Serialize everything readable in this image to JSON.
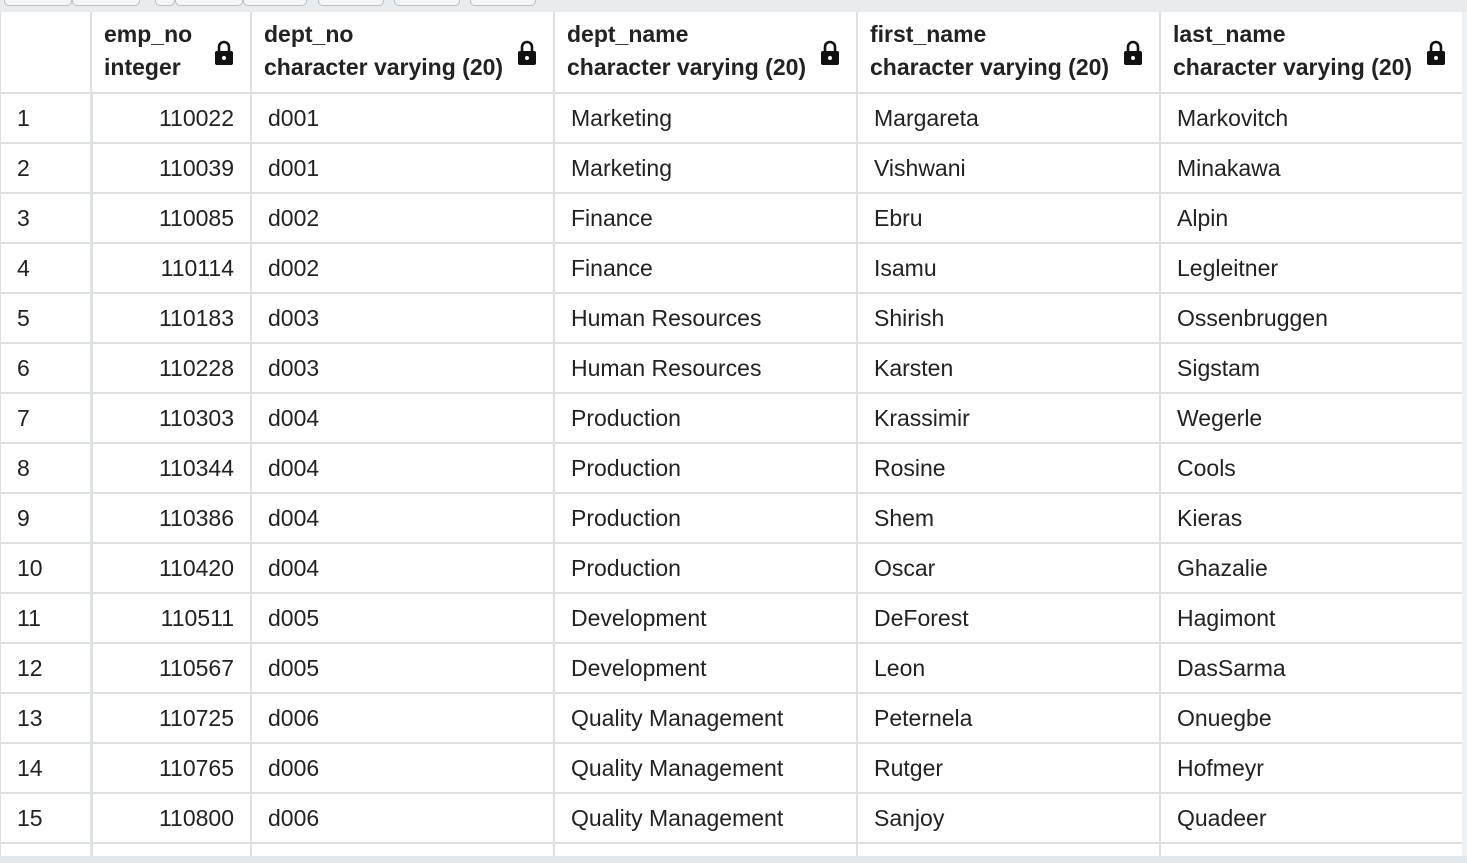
{
  "columns": [
    {
      "name": "emp_no",
      "type": "integer"
    },
    {
      "name": "dept_no",
      "type": "character varying (20)"
    },
    {
      "name": "dept_name",
      "type": "character varying (20)"
    },
    {
      "name": "first_name",
      "type": "character varying (20)"
    },
    {
      "name": "last_name",
      "type": "character varying (20)"
    }
  ],
  "rows": [
    {
      "n": "1",
      "emp_no": "110022",
      "dept_no": "d001",
      "dept_name": "Marketing",
      "first_name": "Margareta",
      "last_name": "Markovitch"
    },
    {
      "n": "2",
      "emp_no": "110039",
      "dept_no": "d001",
      "dept_name": "Marketing",
      "first_name": "Vishwani",
      "last_name": "Minakawa"
    },
    {
      "n": "3",
      "emp_no": "110085",
      "dept_no": "d002",
      "dept_name": "Finance",
      "first_name": "Ebru",
      "last_name": "Alpin"
    },
    {
      "n": "4",
      "emp_no": "110114",
      "dept_no": "d002",
      "dept_name": "Finance",
      "first_name": "Isamu",
      "last_name": "Legleitner"
    },
    {
      "n": "5",
      "emp_no": "110183",
      "dept_no": "d003",
      "dept_name": "Human Resources",
      "first_name": "Shirish",
      "last_name": "Ossenbruggen"
    },
    {
      "n": "6",
      "emp_no": "110228",
      "dept_no": "d003",
      "dept_name": "Human Resources",
      "first_name": "Karsten",
      "last_name": "Sigstam"
    },
    {
      "n": "7",
      "emp_no": "110303",
      "dept_no": "d004",
      "dept_name": "Production",
      "first_name": "Krassimir",
      "last_name": "Wegerle"
    },
    {
      "n": "8",
      "emp_no": "110344",
      "dept_no": "d004",
      "dept_name": "Production",
      "first_name": "Rosine",
      "last_name": "Cools"
    },
    {
      "n": "9",
      "emp_no": "110386",
      "dept_no": "d004",
      "dept_name": "Production",
      "first_name": "Shem",
      "last_name": "Kieras"
    },
    {
      "n": "10",
      "emp_no": "110420",
      "dept_no": "d004",
      "dept_name": "Production",
      "first_name": "Oscar",
      "last_name": "Ghazalie"
    },
    {
      "n": "11",
      "emp_no": "110511",
      "dept_no": "d005",
      "dept_name": "Development",
      "first_name": "DeForest",
      "last_name": "Hagimont"
    },
    {
      "n": "12",
      "emp_no": "110567",
      "dept_no": "d005",
      "dept_name": "Development",
      "first_name": "Leon",
      "last_name": "DasSarma"
    },
    {
      "n": "13",
      "emp_no": "110725",
      "dept_no": "d006",
      "dept_name": "Quality Management",
      "first_name": "Peternela",
      "last_name": "Onuegbe"
    },
    {
      "n": "14",
      "emp_no": "110765",
      "dept_no": "d006",
      "dept_name": "Quality Management",
      "first_name": "Rutger",
      "last_name": "Hofmeyr"
    },
    {
      "n": "15",
      "emp_no": "110800",
      "dept_no": "d006",
      "dept_name": "Quality Management",
      "first_name": "Sanjoy",
      "last_name": "Quadeer"
    }
  ],
  "icons": {
    "column_lock": "lock-icon"
  },
  "colors": {
    "grid_line": "#dde0e4",
    "text": "#222222",
    "toolbar_bg": "#e9ecef"
  }
}
